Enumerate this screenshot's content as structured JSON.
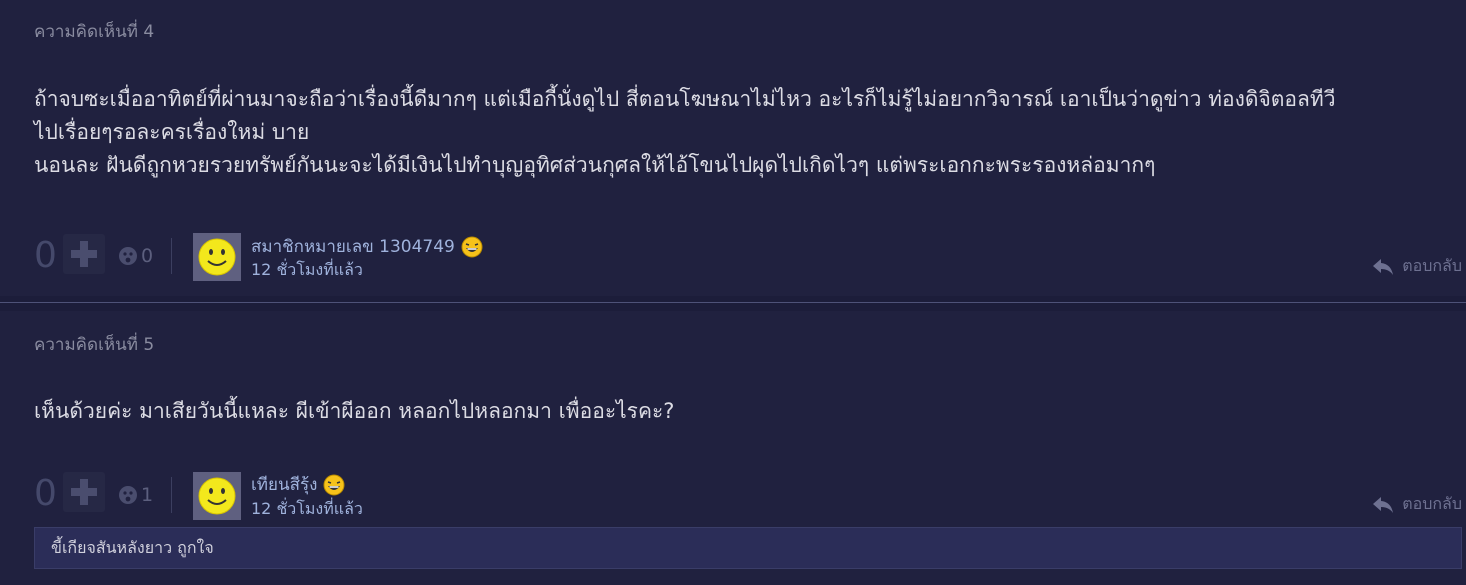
{
  "comments": [
    {
      "number_label": "ความคิดเห็นที่ 4",
      "body_lines": [
        "ถ้าจบซะเมื่ออาทิตย์ที่ผ่านมาจะถือว่าเรื่องนี้ดีมากๆ  แต่เมือกี้นั่งดูไป สี่ตอนโฆษณาไม่ไหว อะไรก็ไม่รู้ไม่อยากวิจารณ์ เอาเป็นว่าดูข่าว ท่องดิจิตอลทีวี",
        "ไปเรื่อยๆรอละครเรื่องใหม่ บาย",
        "นอนละ ฝันดีถูกหวยรวยทรัพย์กันนะจะได้มีเงินไปทำบุญอุทิศส่วนกุศลให้ไอ้โขนไปผุดไปเกิดไวๆ แต่พระเอกกะพระรองหล่อมากๆ"
      ],
      "vote_count": "0",
      "emotion_count": "0",
      "username": "สมาชิกหมายเลข 1304749",
      "timestamp": "12 ชั่วโมงที่แล้ว",
      "reply_label": "ตอบกลับ"
    },
    {
      "number_label": "ความคิดเห็นที่ 5",
      "body_lines": [
        "เห็นด้วยค่ะ มาเสียวันนี้แหละ ผีเข้าผีออก หลอกไปหลอกมา เพื่ออะไรคะ?"
      ],
      "vote_count": "0",
      "emotion_count": "1",
      "username": "เทียนสีรุ้ง",
      "timestamp": "12 ชั่วโมงที่แล้ว",
      "reply_label": "ตอบกลับ",
      "sub_reply_text": "ขี้เกียจสันหลังยาว ถูกใจ"
    }
  ],
  "icons": {
    "plus": "plus-icon",
    "emotion": "emotion-face-icon",
    "avatar": "smiley-avatar",
    "badge": "laughing-face-badge",
    "reply": "reply-arrow-icon"
  },
  "colors": {
    "background": "#20213f",
    "username": "#9fb2dc",
    "avatar_face": "#f3e81c"
  }
}
